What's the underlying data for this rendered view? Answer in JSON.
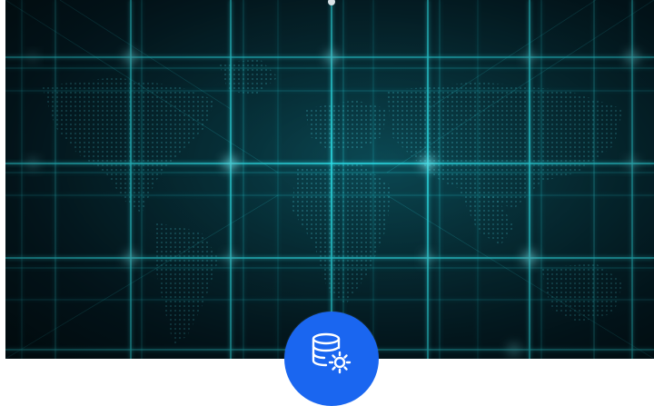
{
  "hero": {
    "icon": "world-map-grid-background",
    "accent": "#2ee6f0",
    "background": "#05212b"
  },
  "scroll_indicator": {
    "icon": "dot-indicator"
  },
  "action_button": {
    "icon": "database-settings-icon",
    "color": "#1a66f0"
  }
}
